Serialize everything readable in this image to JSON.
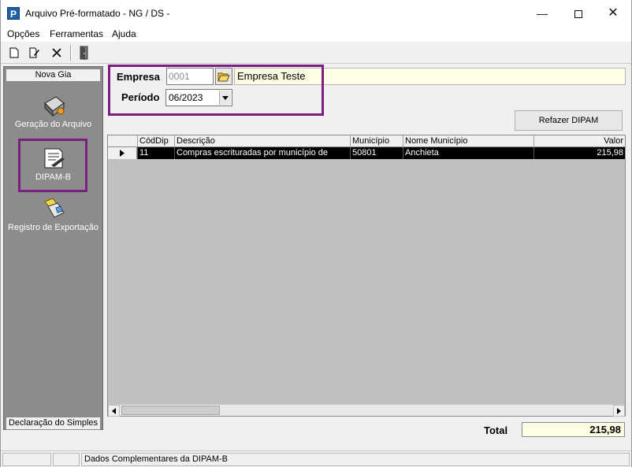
{
  "window": {
    "app_icon_letter": "P",
    "title": "Arquivo Pré-formatado - NG / DS -",
    "minimize_glyph": "—",
    "close_glyph": "✕"
  },
  "menu": [
    "Opções",
    "Ferramentas",
    "Ajuda"
  ],
  "toolbar": {
    "icons": [
      "new-document-icon",
      "edit-document-icon",
      "delete-icon",
      "exit-door-icon"
    ]
  },
  "nav": {
    "header": "Nova Gia",
    "items": [
      {
        "label": "Geração do Arquivo",
        "icon": "file-generation-icon"
      },
      {
        "label": "DIPAM-B",
        "icon": "dipam-document-icon"
      },
      {
        "label": "Registro de Exportação",
        "icon": "export-register-icon"
      }
    ],
    "footer": "Declaração do Simples",
    "highlight_color": "#7b1f7f"
  },
  "filters": {
    "empresa_label": "Empresa",
    "empresa_code": "0001",
    "empresa_name": "Empresa Teste",
    "periodo_label": "Período",
    "periodo_value": "06/2023"
  },
  "refazer_button": "Refazer DIPAM",
  "grid": {
    "columns": [
      "CódDip",
      "Descrição",
      "Município",
      "Nome Município",
      "Valor"
    ],
    "rows": [
      [
        "11",
        "Compras escrituradas por município de",
        "50801",
        "Anchieta",
        "215,98"
      ]
    ]
  },
  "total": {
    "label": "Total",
    "value": "215,98"
  },
  "status": {
    "message": "Dados Complementares da DIPAM-B"
  }
}
